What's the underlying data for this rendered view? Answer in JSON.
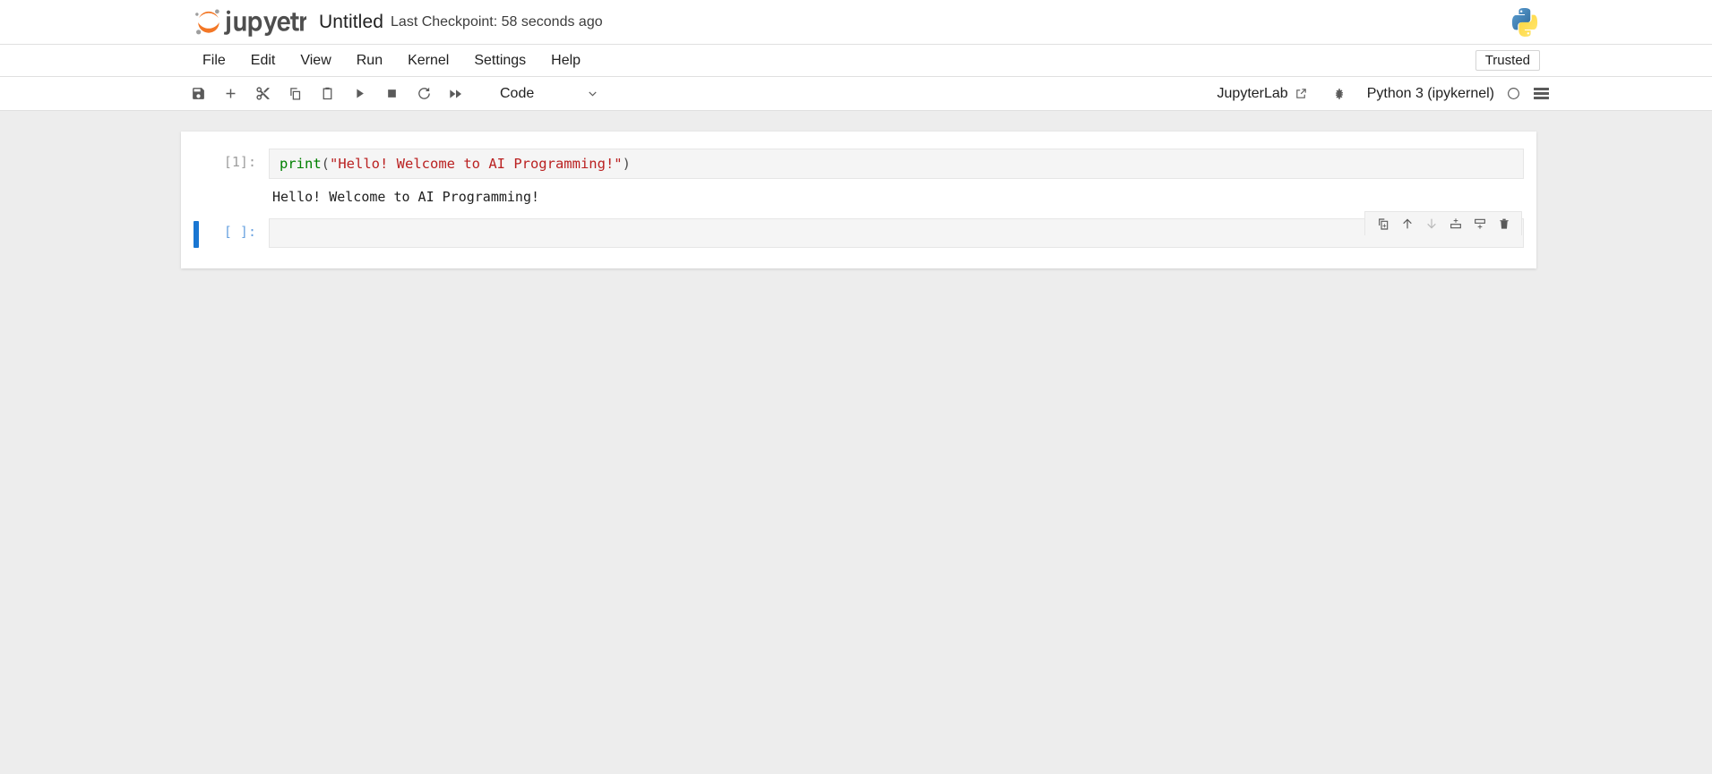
{
  "header": {
    "brand": "jupyter",
    "notebook_title": "Untitled",
    "checkpoint": "Last Checkpoint: 58 seconds ago",
    "python_logo_icon": "python-logo",
    "jupyter_logo_icon": "jupyter-logo"
  },
  "menubar": {
    "items": [
      {
        "label": "File"
      },
      {
        "label": "Edit"
      },
      {
        "label": "View"
      },
      {
        "label": "Run"
      },
      {
        "label": "Kernel"
      },
      {
        "label": "Settings"
      },
      {
        "label": "Help"
      }
    ],
    "trusted_label": "Trusted"
  },
  "toolbar": {
    "buttons": [
      {
        "name": "save-button",
        "icon": "save-icon",
        "title": "Save and create checkpoint"
      },
      {
        "name": "insert-cell-button",
        "icon": "plus-icon",
        "title": "Insert a cell below"
      },
      {
        "name": "cut-button",
        "icon": "scissors-icon",
        "title": "Cut this cell"
      },
      {
        "name": "copy-button",
        "icon": "copy-icon",
        "title": "Copy this cell"
      },
      {
        "name": "paste-button",
        "icon": "paste-icon",
        "title": "Paste this cell from the clipboard"
      },
      {
        "name": "run-button",
        "icon": "play-icon",
        "title": "Run this cell and advance"
      },
      {
        "name": "stop-button",
        "icon": "stop-square-icon",
        "title": "Interrupt the kernel"
      },
      {
        "name": "restart-button",
        "icon": "restart-icon",
        "title": "Restart the kernel"
      },
      {
        "name": "run-all-button",
        "icon": "fast-forward-icon",
        "title": "Restart the kernel and run all cells"
      }
    ],
    "cell_type": "Code",
    "cell_type_chevron_icon": "chevron-down-icon",
    "jupyterlab_label": "JupyterLab",
    "external_link_icon": "external-link-icon",
    "debug_icon": "bug-icon",
    "kernel_name": "Python 3 (ipykernel)",
    "kernel_status_icon": "circle-idle-icon",
    "menu_icon": "hamburger-icon"
  },
  "notebook": {
    "cells": [
      {
        "type": "code",
        "prompt": "[1]:",
        "selected": false,
        "source_tokens": [
          {
            "text": "print",
            "kind": "fn"
          },
          {
            "text": "(",
            "kind": "punc"
          },
          {
            "text": "\"Hello! Welcome to AI Programming!\"",
            "kind": "str"
          },
          {
            "text": ")",
            "kind": "punc"
          }
        ],
        "output": "Hello! Welcome to AI Programming!"
      },
      {
        "type": "code",
        "prompt": "[ ]:",
        "selected": true,
        "source_tokens": [],
        "output": null
      }
    ]
  },
  "cell_actions": [
    {
      "name": "duplicate-cell-button",
      "icon": "duplicate-icon",
      "disabled": false,
      "title": "Duplicate this cell"
    },
    {
      "name": "move-cell-up-button",
      "icon": "arrow-up-icon",
      "disabled": false,
      "title": "Move this cell up"
    },
    {
      "name": "move-cell-down-button",
      "icon": "arrow-down-icon",
      "disabled": true,
      "title": "Move this cell down"
    },
    {
      "name": "insert-above-button",
      "icon": "insert-above-icon",
      "disabled": false,
      "title": "Insert a cell above"
    },
    {
      "name": "insert-below-button",
      "icon": "insert-below-icon",
      "disabled": false,
      "title": "Insert a cell below"
    },
    {
      "name": "delete-cell-button",
      "icon": "trash-icon",
      "disabled": false,
      "title": "Delete this cell"
    }
  ],
  "colors": {
    "accent_blue": "#1976d2",
    "page_background": "#ededed",
    "panel_background": "#ffffff",
    "editor_background": "#f5f5f5",
    "string_token": "#ba2121",
    "function_token": "#008000",
    "prompt_grey": "#9e9e9e"
  }
}
